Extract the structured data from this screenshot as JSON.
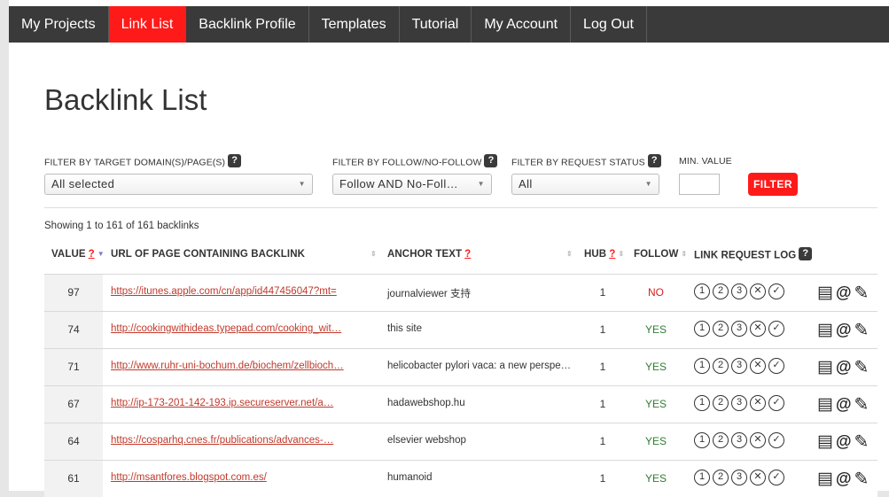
{
  "nav": {
    "items": [
      {
        "label": "My Projects",
        "active": false
      },
      {
        "label": "Link List",
        "active": true
      },
      {
        "label": "Backlink Profile",
        "active": false
      },
      {
        "label": "Templates",
        "active": false
      },
      {
        "label": "Tutorial",
        "active": false
      },
      {
        "label": "My Account",
        "active": false
      },
      {
        "label": "Log Out",
        "active": false
      }
    ]
  },
  "title": "Backlink List",
  "filters": {
    "target": {
      "label": "FILTER BY TARGET DOMAIN(S)/PAGE(S)",
      "value": "All selected"
    },
    "follow": {
      "label": "FILTER BY FOLLOW/NO-FOLLOW",
      "value": "Follow AND No-Foll…"
    },
    "status": {
      "label": "FILTER BY REQUEST STATUS",
      "value": "All"
    },
    "minval": {
      "label": "MIN. VALUE",
      "value": ""
    },
    "button": "FILTER",
    "help": "?"
  },
  "showing": "Showing 1 to 161 of 161 backlinks",
  "table": {
    "headers": {
      "value": "VALUE",
      "url": "URL OF PAGE CONTAINING BACKLINK",
      "anchor": "ANCHOR TEXT",
      "hub": "HUB",
      "follow": "FOLLOW",
      "log": "LINK REQUEST LOG",
      "q": "?"
    },
    "log_marks": [
      "1",
      "2",
      "3",
      "✕",
      "✓"
    ],
    "rows": [
      {
        "value": "97",
        "url": "https://itunes.apple.com/cn/app/id447456047?mt=",
        "anchor": "journalviewer 支持",
        "hub": "1",
        "follow": "NO"
      },
      {
        "value": "74",
        "url": "http://cookingwithideas.typepad.com/cooking_wit…",
        "anchor": "this site",
        "hub": "1",
        "follow": "YES"
      },
      {
        "value": "71",
        "url": "http://www.ruhr-uni-bochum.de/biochem/zellbioch…",
        "anchor": "helicobacter pylori vaca: a new perspe…",
        "hub": "1",
        "follow": "YES"
      },
      {
        "value": "67",
        "url": "http://ip-173-201-142-193.ip.secureserver.net/a…",
        "anchor": "hadawebshop.hu",
        "hub": "1",
        "follow": "YES"
      },
      {
        "value": "64",
        "url": "https://cosparhq.cnes.fr/publications/advances-…",
        "anchor": "elsevier webshop",
        "hub": "1",
        "follow": "YES"
      },
      {
        "value": "61",
        "url": "http://msantfores.blogspot.com.es/",
        "anchor": "humanoid",
        "hub": "1",
        "follow": "YES"
      }
    ]
  },
  "colors": {
    "accent": "#ff1a1a",
    "nav_bg": "#3a3a3a",
    "yes": "#2f7d32",
    "no": "#d62020"
  },
  "icons": [
    "help-icon",
    "dropdown-arrow-icon",
    "sort-icon",
    "copy-icon",
    "email-icon",
    "edit-pencil-icon"
  ]
}
